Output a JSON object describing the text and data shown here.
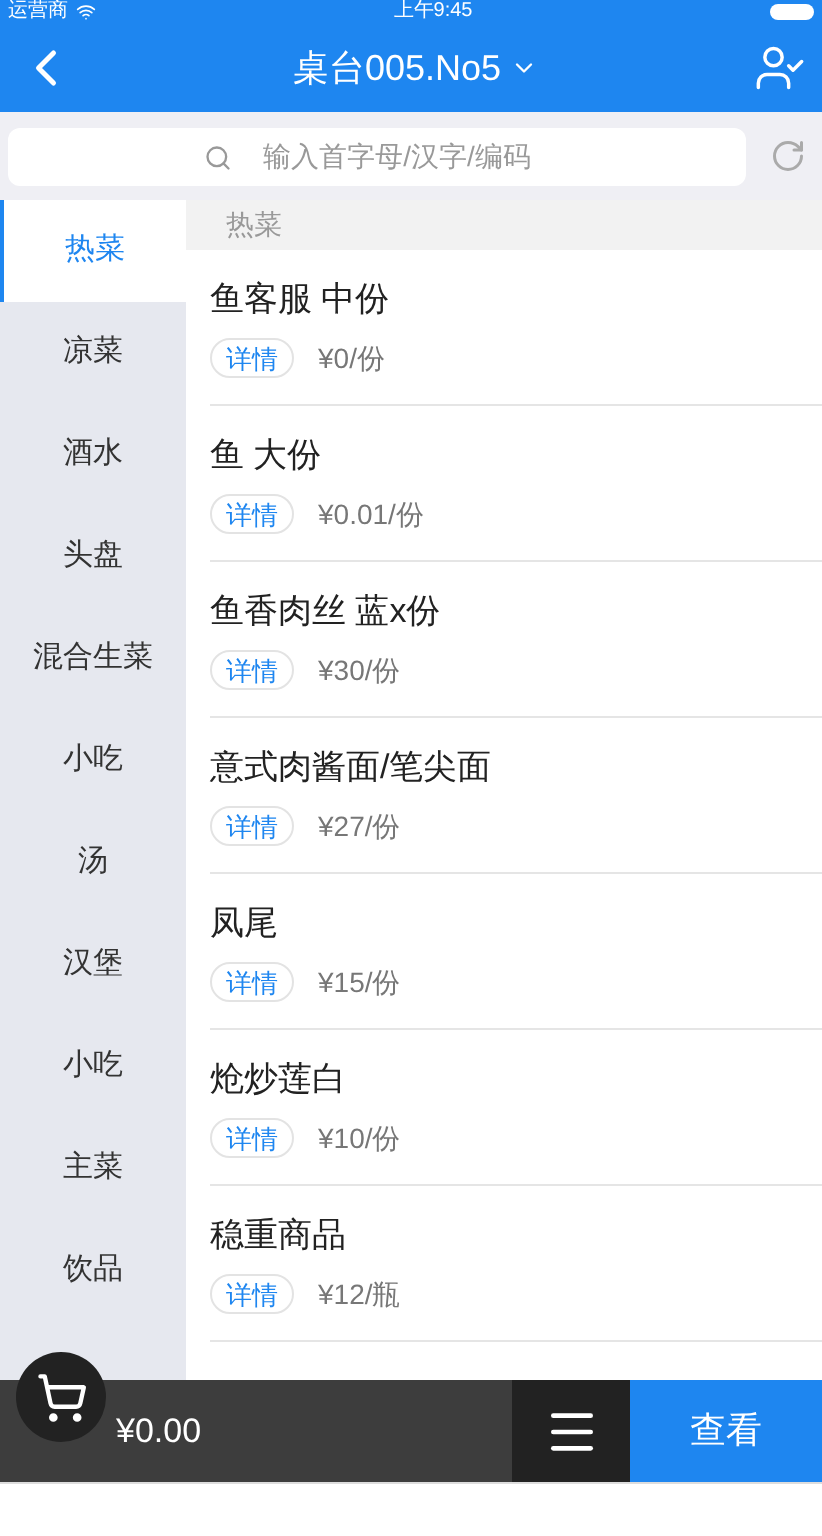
{
  "status_bar": {
    "carrier": "运营商",
    "time": "上午9:45"
  },
  "nav": {
    "title": "桌台005.No5"
  },
  "search": {
    "placeholder": "输入首字母/汉字/编码"
  },
  "categories": [
    {
      "label": "热菜",
      "selected": true
    },
    {
      "label": "凉菜",
      "selected": false
    },
    {
      "label": "酒水",
      "selected": false
    },
    {
      "label": "头盘",
      "selected": false
    },
    {
      "label": "混合生菜",
      "selected": false
    },
    {
      "label": "小吃",
      "selected": false
    },
    {
      "label": "汤",
      "selected": false
    },
    {
      "label": "汉堡",
      "selected": false
    },
    {
      "label": "小吃",
      "selected": false
    },
    {
      "label": "主菜",
      "selected": false
    },
    {
      "label": "饮品",
      "selected": false
    }
  ],
  "section_title": "热菜",
  "dishes": [
    {
      "name": "鱼客服 中份",
      "detail": "详情",
      "price": "¥0/份"
    },
    {
      "name": "鱼 大份",
      "detail": "详情",
      "price": "¥0.01/份"
    },
    {
      "name": "鱼香肉丝 蓝x份",
      "detail": "详情",
      "price": "¥30/份"
    },
    {
      "name": "意式肉酱面/笔尖面",
      "detail": "详情",
      "price": "¥27/份"
    },
    {
      "name": "凤尾",
      "detail": "详情",
      "price": "¥15/份"
    },
    {
      "name": "炝炒莲白",
      "detail": "详情",
      "price": "¥10/份"
    },
    {
      "name": "稳重商品",
      "detail": "详情",
      "price": "¥12/瓶"
    }
  ],
  "cart": {
    "total": "¥0.00",
    "view_button": "查看"
  }
}
